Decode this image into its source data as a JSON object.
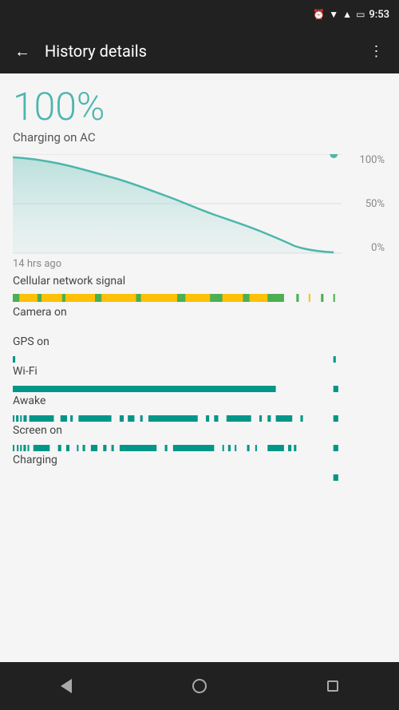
{
  "statusBar": {
    "time": "9:53",
    "icons": [
      "alarm",
      "wifi-full",
      "signal-full",
      "battery-charging"
    ]
  },
  "appBar": {
    "title": "History details",
    "backLabel": "←",
    "menuLabel": "⋮"
  },
  "battery": {
    "percent": "100%",
    "chargingStatus": "Charging on AC"
  },
  "chartLabels": {
    "top": "100%",
    "mid": "50%",
    "bottom": "0%",
    "timeLabel": "14 hrs ago"
  },
  "activities": [
    {
      "label": "Cellular network signal",
      "type": "cellular"
    },
    {
      "label": "Camera on",
      "type": "camera"
    },
    {
      "label": "GPS on",
      "type": "gps"
    },
    {
      "label": "Wi-Fi",
      "type": "wifi"
    },
    {
      "label": "Awake",
      "type": "awake"
    },
    {
      "label": "Screen on",
      "type": "screen"
    },
    {
      "label": "Charging",
      "type": "charging"
    }
  ],
  "navBar": {
    "back": "back",
    "home": "home",
    "recents": "recents"
  }
}
